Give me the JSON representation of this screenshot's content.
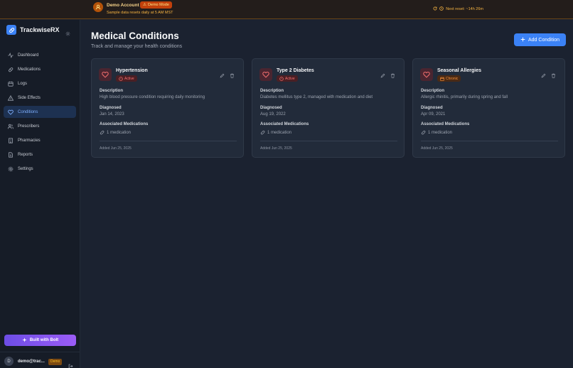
{
  "banner": {
    "title": "Demo Account",
    "badge": "Demo Mode",
    "subtitle": "Sample data resets daily at 5 AM MST",
    "reset": "Next reset: ~14h 26m"
  },
  "sidebar": {
    "app_name": "TrackwiseRX",
    "items": [
      {
        "label": "Dashboard",
        "icon": "activity-icon"
      },
      {
        "label": "Medications",
        "icon": "pill-icon"
      },
      {
        "label": "Logs",
        "icon": "calendar-icon"
      },
      {
        "label": "Side Effects",
        "icon": "warning-icon"
      },
      {
        "label": "Conditions",
        "icon": "heart-icon",
        "active": true
      },
      {
        "label": "Prescribers",
        "icon": "users-icon"
      },
      {
        "label": "Pharmacies",
        "icon": "building-icon"
      },
      {
        "label": "Reports",
        "icon": "file-icon"
      },
      {
        "label": "Settings",
        "icon": "gear-icon"
      }
    ],
    "bolt_label": "Built with Bolt",
    "user": {
      "avatar": "D",
      "email": "demo@trac...",
      "badge": "Demo"
    }
  },
  "main": {
    "title": "Medical Conditions",
    "subtitle": "Track and manage your health conditions",
    "add_button": "Add Condition",
    "cards": [
      {
        "name": "Hypertension",
        "status": "Active",
        "description_label": "Description",
        "description": "High blood pressure condition requiring daily monitoring",
        "diagnosed_label": "Diagnosed",
        "diagnosed": "Jan 14, 2023",
        "meds_label": "Associated Medications",
        "meds": "1 medication",
        "added": "Added Jun 25, 2025"
      },
      {
        "name": "Type 2 Diabetes",
        "status": "Active",
        "description_label": "Description",
        "description": "Diabetes mellitus type 2, managed with medication and diet",
        "diagnosed_label": "Diagnosed",
        "diagnosed": "Aug 19, 2022",
        "meds_label": "Associated Medications",
        "meds": "1 medication",
        "added": "Added Jun 25, 2025"
      },
      {
        "name": "Seasonal Allergies",
        "status": "Chronic",
        "description_label": "Description",
        "description": "Allergic rhinitis, primarily during spring and fall",
        "diagnosed_label": "Diagnosed",
        "diagnosed": "Apr 09, 2021",
        "meds_label": "Associated Medications",
        "meds": "1 medication",
        "added": "Added Jun 25, 2025"
      }
    ]
  }
}
